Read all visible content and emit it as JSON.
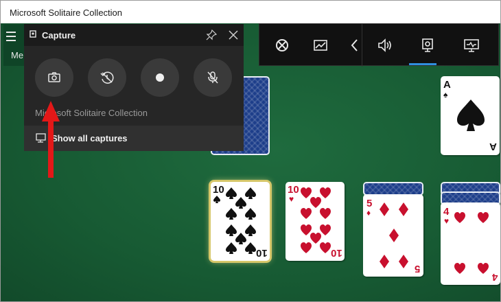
{
  "window": {
    "title": "Microsoft Solitaire Collection"
  },
  "menu": {
    "label": "Me"
  },
  "capture_widget": {
    "title": "Capture",
    "game_name": "Microsoft Solitaire Collection",
    "show_all_label": "Show all captures",
    "buttons": [
      "screenshot",
      "record-last",
      "record",
      "mic-toggle"
    ]
  },
  "game_bar": {
    "items": [
      "xbox-icon",
      "performance-icon",
      "collapse-icon",
      "audio-icon",
      "capture-icon",
      "resources-icon"
    ],
    "active": "capture-icon",
    "accent": "#2f8fdf"
  },
  "cards": {
    "ace": {
      "rank": "A",
      "suit": "♠"
    },
    "ten_spades": {
      "rank": "10",
      "suit": "♠"
    },
    "ten_hearts": {
      "rank": "10",
      "suit": "♥"
    },
    "five_diamonds": {
      "rank": "5",
      "suit": "♦"
    },
    "four_hearts": {
      "rank": "4",
      "suit": "♥"
    }
  },
  "colors": {
    "felt": "#1a5e36",
    "card_red": "#c8102e",
    "annotation_arrow": "#e31818"
  }
}
